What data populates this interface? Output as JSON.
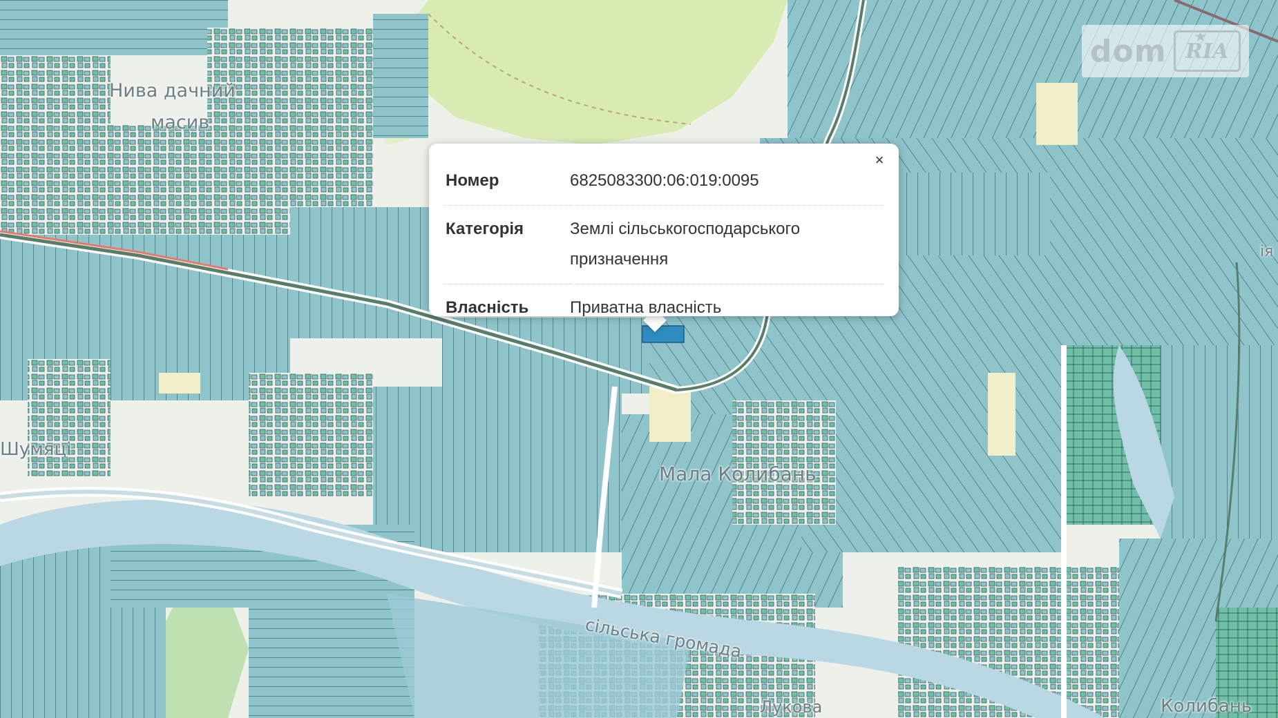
{
  "map": {
    "palette": {
      "parcel": "#8fc4cb",
      "parcel_dark": "#6aa8b1",
      "parcel_green": "#6fbfa6",
      "parcel_line": "#2e5d66",
      "background": "#eef0ea",
      "forest": "#d8ebb3",
      "forest_light": "#e3f0c7",
      "field_yellow": "#f1efc9",
      "road": "#5a7d6a",
      "railway": "#8a6a6a",
      "river": "#b9d8e3",
      "highlight": "#2f8cc0",
      "label": "#6c7f85"
    },
    "place_labels": [
      {
        "text": "Нива дачний",
        "kind": "settlement"
      },
      {
        "text": "масив",
        "kind": "settlement"
      },
      {
        "text": "Шумяці",
        "kind": "settlement"
      },
      {
        "text": "Мала Колибань",
        "kind": "settlement"
      },
      {
        "text": "сільська громада",
        "kind": "admin"
      },
      {
        "text": "Лукова",
        "kind": "street"
      },
      {
        "text": "Колибань",
        "kind": "settlement"
      },
      {
        "text": "ія",
        "kind": "edge"
      }
    ]
  },
  "logo": {
    "dom": "dom",
    "ria": "RIA"
  },
  "popup": {
    "close_icon": "×",
    "rows": [
      {
        "key": "Номер",
        "value": "6825083300:06:019:0095"
      },
      {
        "key": "Категорія",
        "value": "Землі сільськогосподарського призначення"
      },
      {
        "key": "Власність",
        "value": "Приватна власність"
      }
    ]
  }
}
